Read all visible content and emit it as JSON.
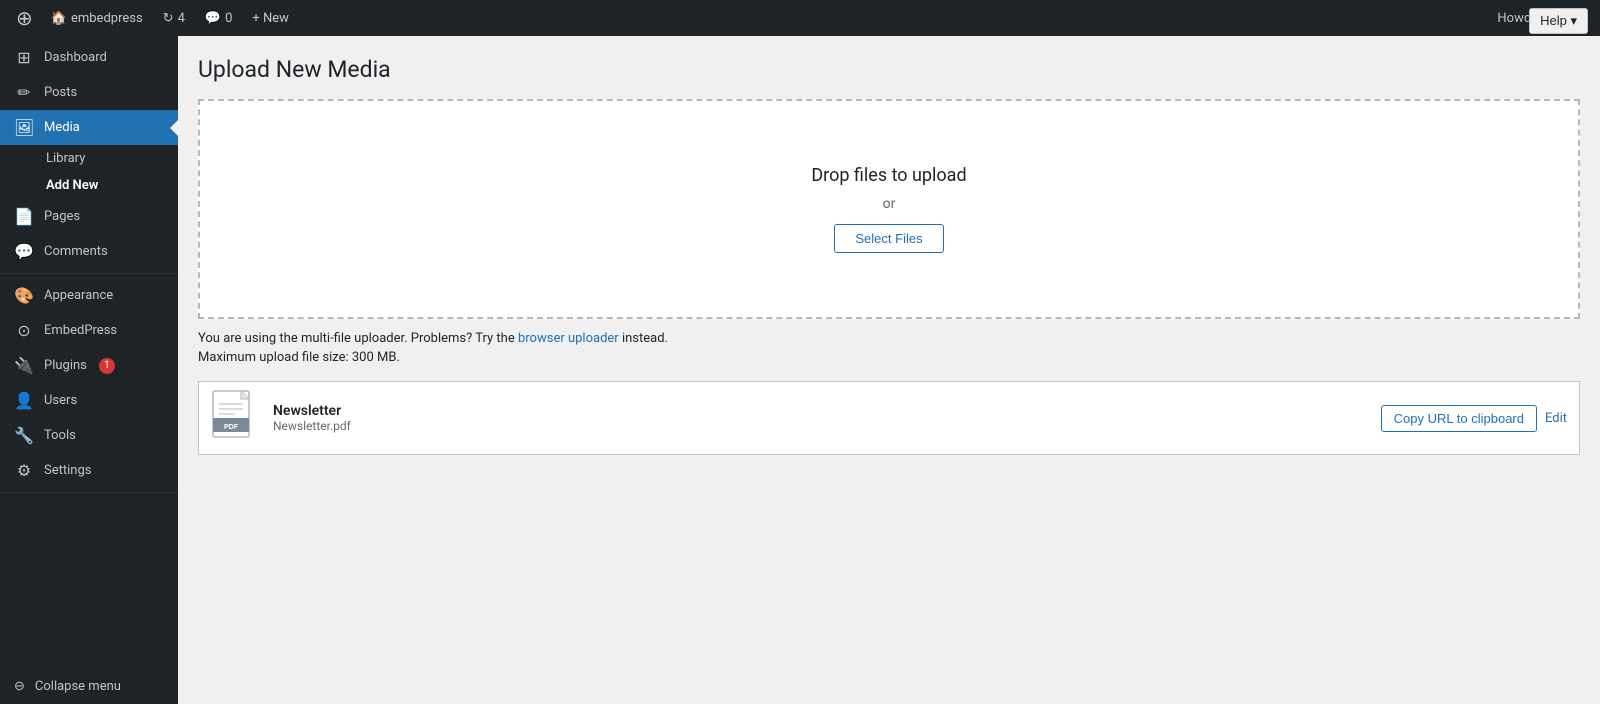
{
  "adminbar": {
    "logo": "⊕",
    "site_name": "embedpress",
    "updates_count": "4",
    "comments_count": "0",
    "new_label": "+ New",
    "howdy": "Howdy, Admin",
    "help_label": "Help ▾"
  },
  "sidebar": {
    "items": [
      {
        "id": "dashboard",
        "label": "Dashboard",
        "icon": "⊞"
      },
      {
        "id": "posts",
        "label": "Posts",
        "icon": "✏"
      },
      {
        "id": "media",
        "label": "Media",
        "icon": "🖼",
        "active": true
      },
      {
        "id": "pages",
        "label": "Pages",
        "icon": "📄"
      },
      {
        "id": "comments",
        "label": "Comments",
        "icon": "💬"
      },
      {
        "id": "appearance",
        "label": "Appearance",
        "icon": "🎨"
      },
      {
        "id": "embedpress",
        "label": "EmbedPress",
        "icon": "⊙"
      },
      {
        "id": "plugins",
        "label": "Plugins",
        "icon": "🔌",
        "badge": "1"
      },
      {
        "id": "users",
        "label": "Users",
        "icon": "👤"
      },
      {
        "id": "tools",
        "label": "Tools",
        "icon": "🔧"
      },
      {
        "id": "settings",
        "label": "Settings",
        "icon": "⚙"
      }
    ],
    "media_sub": [
      {
        "label": "Library",
        "active": false
      },
      {
        "label": "Add New",
        "active": true
      }
    ],
    "collapse": "Collapse menu"
  },
  "main": {
    "page_title": "Upload New Media",
    "upload": {
      "drop_text": "Drop files to upload",
      "or_text": "or",
      "select_btn": "Select Files",
      "info_text_before": "You are using the multi-file uploader. Problems? Try the ",
      "browser_uploader_link": "browser uploader",
      "info_text_after": " instead.",
      "max_size": "Maximum upload file size: 300 MB."
    },
    "file": {
      "name": "Newsletter",
      "filename": "Newsletter.pdf",
      "copy_url_btn": "Copy URL to clipboard",
      "edit_link": "Edit"
    }
  }
}
